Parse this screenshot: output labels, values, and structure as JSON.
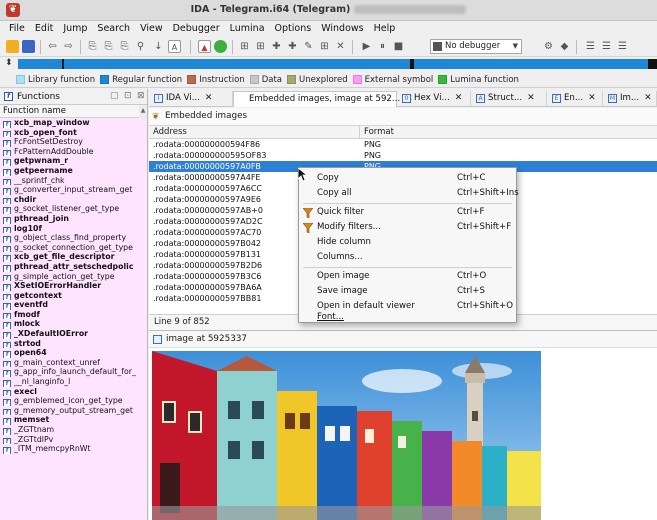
{
  "window": {
    "title": "IDA - Telegram.i64 (Telegram)"
  },
  "menu": [
    "File",
    "Edit",
    "Jump",
    "Search",
    "View",
    "Debugger",
    "Lumina",
    "Options",
    "Windows",
    "Help"
  ],
  "toolbar": {
    "debugger_select": "No debugger"
  },
  "legend": [
    {
      "label": "Library function",
      "color": "#a8e4f8"
    },
    {
      "label": "Regular function",
      "color": "#1f88d6"
    },
    {
      "label": "Instruction",
      "color": "#b07050"
    },
    {
      "label": "Data",
      "color": "#c8c8c8"
    },
    {
      "label": "Unexplored",
      "color": "#a8a868"
    },
    {
      "label": "External symbol",
      "color": "#ff99ff"
    },
    {
      "label": "Lumina function",
      "color": "#33bb33"
    }
  ],
  "functions_panel": {
    "tab_label": "Functions",
    "column_header": "Function name",
    "icon_letter": "f",
    "items": [
      {
        "name": "xcb_map_window",
        "bold": true
      },
      {
        "name": "xcb_open_font",
        "bold": true
      },
      {
        "name": "FcFontSetDestroy",
        "bold": false
      },
      {
        "name": "FcPatternAddDouble",
        "bold": false
      },
      {
        "name": "getpwnam_r",
        "bold": true
      },
      {
        "name": "getpeername",
        "bold": true
      },
      {
        "name": "__sprintf_chk",
        "bold": false
      },
      {
        "name": "g_converter_input_stream_get",
        "bold": false
      },
      {
        "name": "chdir",
        "bold": true
      },
      {
        "name": "g_socket_listener_get_type",
        "bold": false
      },
      {
        "name": "pthread_join",
        "bold": true
      },
      {
        "name": "log10f",
        "bold": true
      },
      {
        "name": "g_object_class_find_property",
        "bold": false
      },
      {
        "name": "g_socket_connection_get_type",
        "bold": false
      },
      {
        "name": "xcb_get_file_descriptor",
        "bold": true
      },
      {
        "name": "pthread_attr_setschedpolic",
        "bold": true
      },
      {
        "name": "g_simple_action_get_type",
        "bold": false
      },
      {
        "name": "XSetIOErrorHandler",
        "bold": true
      },
      {
        "name": "getcontext",
        "bold": true
      },
      {
        "name": "eventfd",
        "bold": true
      },
      {
        "name": "fmodf",
        "bold": true
      },
      {
        "name": "mlock",
        "bold": true
      },
      {
        "name": "_XDefaultIOError",
        "bold": true
      },
      {
        "name": "strtod",
        "bold": true
      },
      {
        "name": "open64",
        "bold": true
      },
      {
        "name": "g_main_context_unref",
        "bold": false
      },
      {
        "name": "g_app_info_launch_default_for_",
        "bold": false
      },
      {
        "name": "__nl_langinfo_l",
        "bold": false
      },
      {
        "name": "execl",
        "bold": true
      },
      {
        "name": "g_emblemed_icon_get_type",
        "bold": false
      },
      {
        "name": "g_memory_output_stream_get",
        "bold": false
      },
      {
        "name": "memset",
        "bold": true
      },
      {
        "name": "_ZGTtnam",
        "bold": false
      },
      {
        "name": "_ZGTtdlPv",
        "bold": false
      },
      {
        "name": "_ITM_memcpyRnWt",
        "bold": false
      }
    ]
  },
  "tabs": [
    {
      "label": "IDA Vi...",
      "icon": "I"
    },
    {
      "label": "Embedded images, image at 592...",
      "icon": ""
    },
    {
      "label": "Hex Vi...",
      "icon": "0"
    },
    {
      "label": "Struct...",
      "icon": "A"
    },
    {
      "label": "En...",
      "icon": "E"
    },
    {
      "label": "Im...",
      "icon": "M"
    }
  ],
  "embedded_panel": {
    "title": "Embedded images",
    "col_address": "Address",
    "col_format": "Format",
    "rows": [
      {
        "address": ".rodata:000000000594F86",
        "format": "PNG"
      },
      {
        "address": ".rodata:000000000595OF83",
        "format": "PNG"
      },
      {
        "address": ".rodata:00000000597A0FB",
        "format": "PNG"
      },
      {
        "address": ".rodata:00000000597A4FE",
        "format": ""
      },
      {
        "address": ".rodata:00000000597A6CC",
        "format": ""
      },
      {
        "address": ".rodata:00000000597A9E6",
        "format": ""
      },
      {
        "address": ".rodata:00000000597AB+0",
        "format": ""
      },
      {
        "address": ".rodata:00000000597AD2C",
        "format": ""
      },
      {
        "address": ".rodata:00000000597AC70",
        "format": ""
      },
      {
        "address": ".rodata:00000000597B042",
        "format": ""
      },
      {
        "address": ".rodata:00000000597B131",
        "format": ""
      },
      {
        "address": ".rodata:00000000597B2D6",
        "format": ""
      },
      {
        "address": ".rodata:00000000597B3C6",
        "format": ""
      },
      {
        "address": ".rodata:00000000597BA6A",
        "format": ""
      },
      {
        "address": ".rodata:00000000597BB81",
        "format": ""
      }
    ],
    "status": "Line 9 of 852"
  },
  "image_panel": {
    "title": "image at 5925337"
  },
  "context_menu": {
    "items": [
      {
        "label": "Copy",
        "shortcut": "Ctrl+C",
        "icon": ""
      },
      {
        "label": "Copy all",
        "shortcut": "Ctrl+Shift+Ins",
        "icon": ""
      },
      {
        "label": "Quick filter",
        "shortcut": "Ctrl+F",
        "icon": "filter-icon"
      },
      {
        "label": "Modify filters...",
        "shortcut": "Ctrl+Shift+F",
        "icon": "filter-icon"
      },
      {
        "label": "Hide column",
        "shortcut": "",
        "icon": ""
      },
      {
        "label": "Columns...",
        "shortcut": "",
        "icon": ""
      },
      {
        "label": "Open image",
        "shortcut": "Ctrl+O",
        "icon": ""
      },
      {
        "label": "Save image",
        "shortcut": "Ctrl+S",
        "icon": ""
      },
      {
        "label": "Open in default viewer",
        "shortcut": "Ctrl+Shift+O",
        "icon": ""
      },
      {
        "label": "Font...",
        "shortcut": "",
        "icon": ""
      }
    ]
  }
}
